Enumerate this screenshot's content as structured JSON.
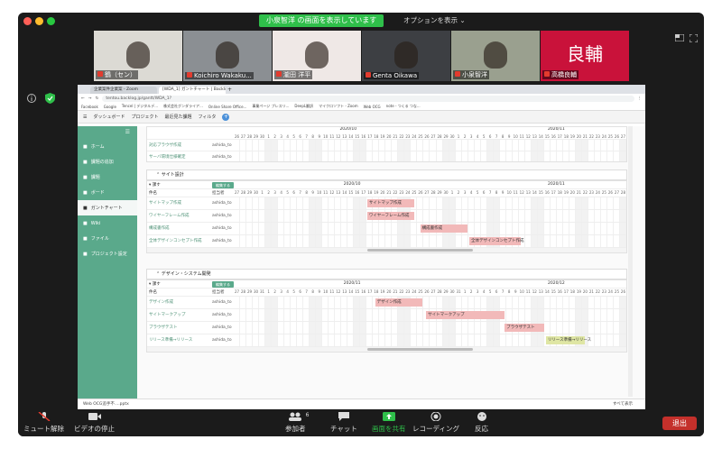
{
  "zoom": {
    "share_banner": "小泉智洋 の画面を表示しています",
    "options_label": "オプションを表示 ⌄",
    "participants": [
      {
        "name": "鶴（セン）",
        "bg": "#dcdad4"
      },
      {
        "name": "Koichiro Wakaku...",
        "bg": "#8b8f93"
      },
      {
        "name": "瀧田 洋平",
        "bg": "#efe8e6"
      },
      {
        "name": "Genta Oikawa",
        "bg": "#3d3f43"
      },
      {
        "name": "小泉智洋",
        "bg": "#9aa08f"
      },
      {
        "name": "高橋良輔",
        "bg": "#c9123a",
        "avatar_text": "良輔"
      }
    ],
    "toolbar": {
      "mute": "ミュート解除",
      "video": "ビデオの停止",
      "participants": "参加者",
      "participants_count": "6",
      "chat": "チャット",
      "share": "画面を共有",
      "record": "レコーディング",
      "reactions": "反応",
      "end": "退出"
    }
  },
  "browser": {
    "tabs": [
      "企業案件企業案 - Zoom",
      "[WDA_1] ガントチャート | Backlog"
    ],
    "url": "tentou.backlog.jp/gantt/WDA_1?",
    "bookmarks": [
      "Facebook",
      "Google",
      "Tencel | デジタルデ...",
      "株式会社グンダライア...",
      "Online Share Office...",
      "事業ページ プレスリ...",
      "DeepL翻訳",
      "マイクロソフト - Zoom",
      "Web OCG",
      "note - つくる つな..."
    ],
    "app_nav": [
      "ダッシュボード",
      "プロジェクト",
      "最近見た課題",
      "フィルタ"
    ],
    "sidebar": [
      "ホーム",
      "課題の追加",
      "課題",
      "ボード",
      "ガントチャート",
      "Wiki",
      "ファイル",
      "プロジェクト設定"
    ],
    "download": "Web OCG追手不....pptx",
    "show_all": "すべて表示"
  },
  "gantt": {
    "top_rows": [
      {
        "name": "対応ブラウザ作成",
        "assignee": "ashida_to"
      },
      {
        "name": "サーバ環境仕様確定",
        "assignee": "ashida_to"
      }
    ],
    "top_month": "2020/10",
    "top_month2": "2020/11",
    "sections": [
      {
        "title": "サイト設計",
        "month_a": "2020/10",
        "month_b": "2020/11",
        "col_name": "件名",
        "col_asg": "担当者",
        "filter": "課す",
        "btn": "編集する",
        "rows": [
          {
            "name": "サイトマップ作成",
            "assignee": "ashida_to",
            "bar": "サイトマップ作成",
            "start": 0.34,
            "len": 0.12,
            "color": "#f2b9b9"
          },
          {
            "name": "ワイヤーフレーム作成",
            "assignee": "ashida_to",
            "bar": "ワイヤーフレーム作成",
            "start": 0.34,
            "len": 0.12,
            "color": "#f2b9b9"
          },
          {
            "name": "構成書作成",
            "assignee": "ashida_to",
            "bar": "構成書作成",
            "start": 0.475,
            "len": 0.12,
            "color": "#f2b9b9"
          },
          {
            "name": "全体デザインコンセプト作成",
            "assignee": "ashida_to",
            "bar": "全体デザインコンセプト作成",
            "start": 0.6,
            "len": 0.13,
            "color": "#f2b9b9"
          }
        ]
      },
      {
        "title": "デザイン・システム開発",
        "month_a": "2020/11",
        "month_b": "2020/12",
        "col_name": "件名",
        "col_asg": "担当者",
        "filter": "課す",
        "btn": "編集する",
        "rows": [
          {
            "name": "デザイン作成",
            "assignee": "ashida_to",
            "bar": "デザイン作成",
            "start": 0.36,
            "len": 0.12,
            "color": "#f2b9b9"
          },
          {
            "name": "サイトマークアップ",
            "assignee": "ashida_to",
            "bar": "サイトマークアップ",
            "start": 0.49,
            "len": 0.2,
            "color": "#f2b9b9"
          },
          {
            "name": "ブラウザテスト",
            "assignee": "ashida_to",
            "bar": "ブラウザテスト",
            "start": 0.69,
            "len": 0.1,
            "color": "#f2b9b9"
          },
          {
            "name": "リリース準備→リリース",
            "assignee": "ashida_to",
            "bar": "リリース準備→リリース",
            "start": 0.795,
            "len": 0.1,
            "color": "#dfe6a4"
          }
        ]
      }
    ]
  }
}
